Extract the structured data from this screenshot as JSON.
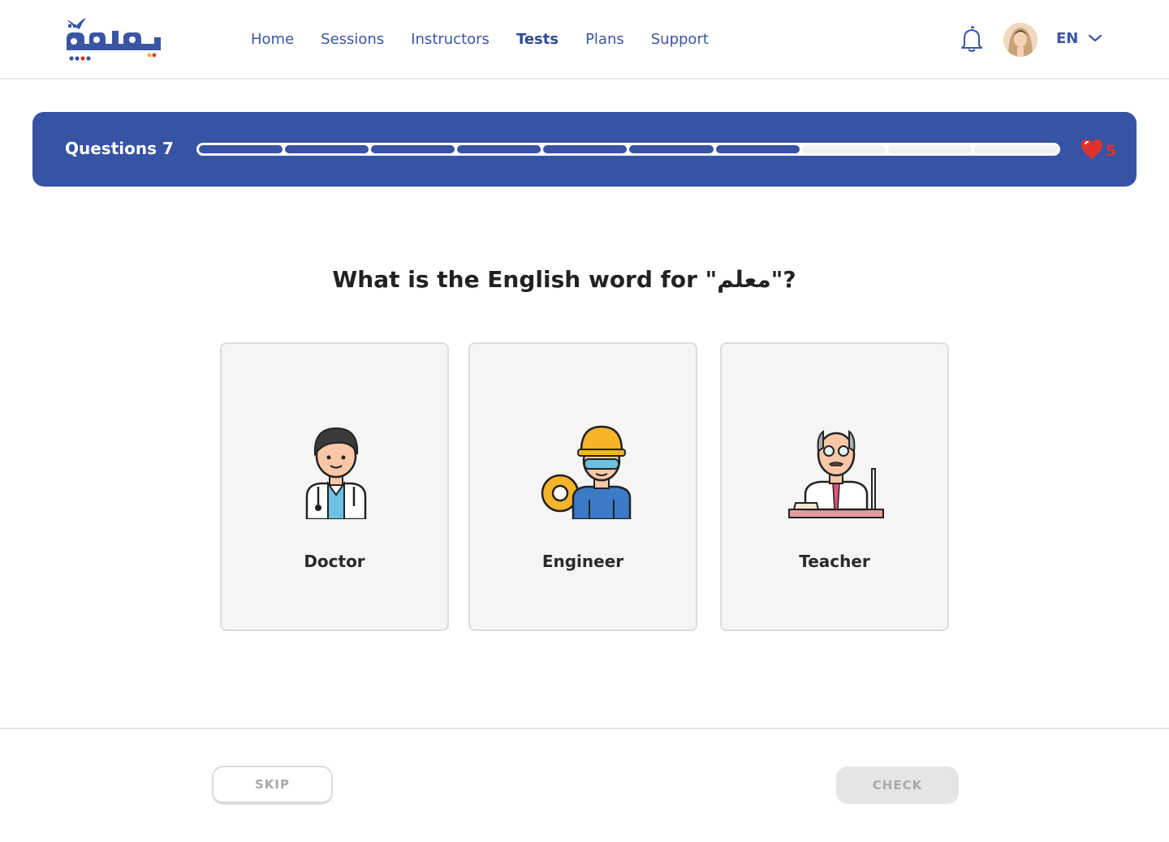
{
  "header": {
    "logo_name": "yamama-logo",
    "nav": [
      {
        "label": "Home",
        "active": false
      },
      {
        "label": "Sessions",
        "active": false
      },
      {
        "label": "Instructors",
        "active": false
      },
      {
        "label": "Tests",
        "active": true
      },
      {
        "label": "Plans",
        "active": false
      },
      {
        "label": "Support",
        "active": false
      }
    ],
    "language": "EN"
  },
  "progress": {
    "title": "Questions 7",
    "total_segments": 10,
    "completed_segments": 7,
    "lives": "5",
    "bar_color": "#3653a4",
    "heart_color": "#e0322d"
  },
  "question": {
    "text": "What is the English word for \"معلم\"?"
  },
  "options": [
    {
      "label": "Doctor",
      "icon": "doctor-icon"
    },
    {
      "label": "Engineer",
      "icon": "engineer-icon"
    },
    {
      "label": "Teacher",
      "icon": "teacher-icon"
    }
  ],
  "footer": {
    "skip_label": "SKIP",
    "check_label": "CHECK"
  },
  "colors": {
    "brand": "#3a55a4",
    "banner": "#3653a4"
  }
}
